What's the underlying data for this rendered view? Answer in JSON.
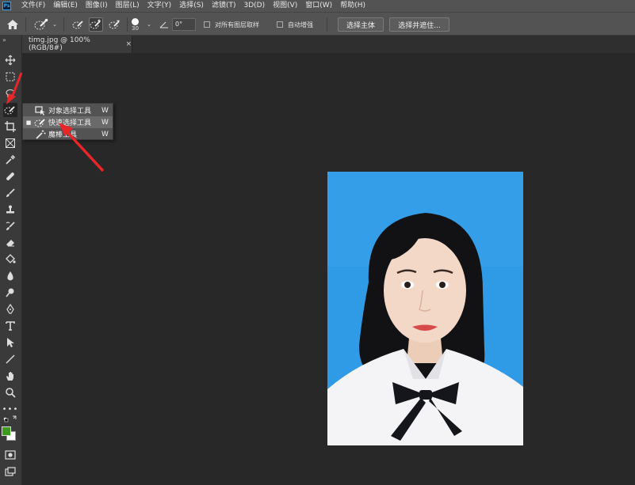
{
  "app": {
    "logo_text": "Ps"
  },
  "menu": [
    {
      "label": "文件(F)"
    },
    {
      "label": "编辑(E)"
    },
    {
      "label": "图像(I)"
    },
    {
      "label": "图层(L)"
    },
    {
      "label": "文字(Y)"
    },
    {
      "label": "选择(S)"
    },
    {
      "label": "滤镜(T)"
    },
    {
      "label": "3D(D)"
    },
    {
      "label": "视图(V)"
    },
    {
      "label": "窗口(W)"
    },
    {
      "label": "帮助(H)"
    }
  ],
  "options": {
    "brush_size": "30",
    "angle_value": "0°",
    "sample_all_layers": "对所有图层取样",
    "auto_enhance": "自动增强",
    "select_subject": "选择主体",
    "select_and_mask": "选择并遮住..."
  },
  "document": {
    "tab_title": "timg.jpg @ 100%(RGB/8#)",
    "close_glyph": "×"
  },
  "flyout": {
    "items": [
      {
        "label": "对象选择工具",
        "shortcut": "W",
        "active": false
      },
      {
        "label": "快速选择工具",
        "shortcut": "W",
        "active": true
      },
      {
        "label": "魔棒工具",
        "shortcut": "W",
        "active": false
      }
    ]
  },
  "colors": {
    "foreground": "#3e9a1e",
    "background": "#ffffff",
    "photo_backdrop": "#2f9ae6",
    "annotation_arrow": "#e8262a"
  },
  "toolbar_icons": [
    "move-icon",
    "marquee-icon",
    "lasso-icon",
    "quick-selection-icon",
    "crop-icon",
    "frame-icon",
    "eyedropper-icon",
    "healing-brush-icon",
    "brush-icon",
    "clone-stamp-icon",
    "history-brush-icon",
    "eraser-icon",
    "paint-bucket-icon",
    "blur-icon",
    "dodge-icon",
    "pen-icon",
    "type-icon",
    "path-selection-icon",
    "line-icon",
    "hand-icon",
    "zoom-icon",
    "more-tools-icon",
    "quick-mask-icon",
    "screen-mode-icon"
  ]
}
